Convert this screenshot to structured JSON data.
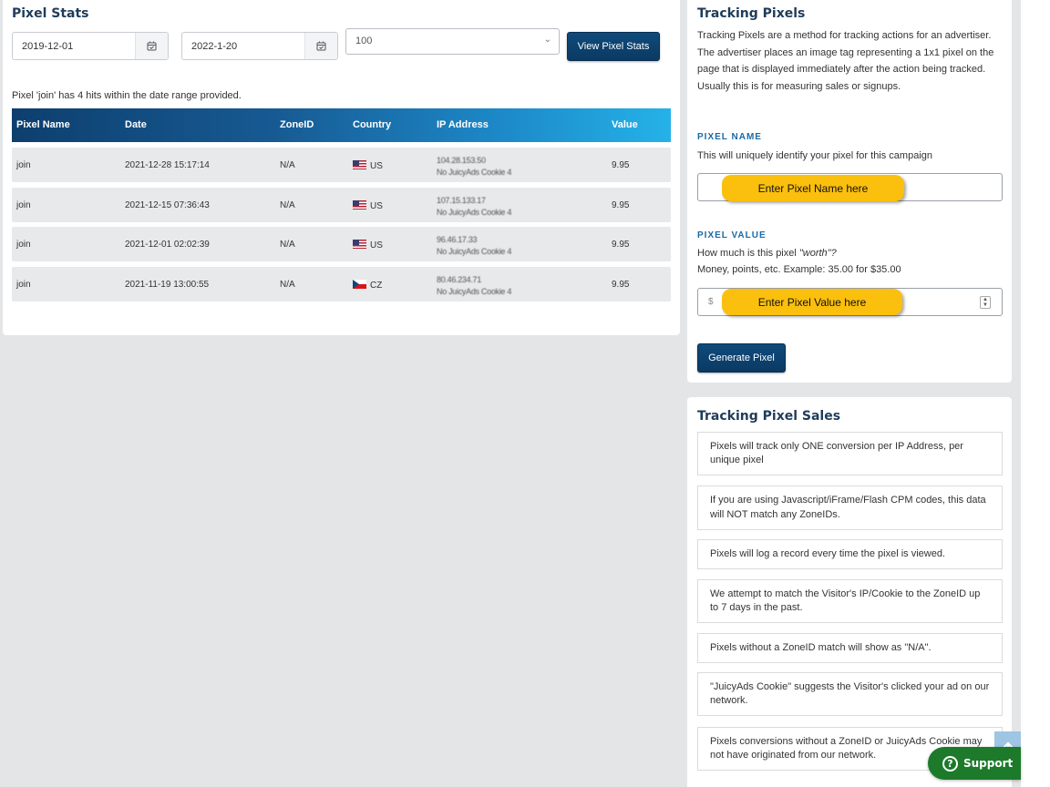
{
  "stats": {
    "title": "Pixel Stats",
    "start_date": "2019-12-01",
    "end_date": "2022-1-20",
    "limit": "100",
    "view_button": "View Pixel Stats",
    "info": "Pixel 'join' has 4 hits within the date range provided.",
    "columns": [
      "Pixel Name",
      "Date",
      "ZoneID",
      "Country",
      "IP Address",
      "Value"
    ],
    "rows": [
      {
        "name": "join",
        "date": "2021-12-28 15:17:14",
        "zone": "N/A",
        "country": "US",
        "ip": "104.28.153.50",
        "source": "No JuicyAds Cookie 4",
        "value": "9.95"
      },
      {
        "name": "join",
        "date": "2021-12-15 07:36:43",
        "zone": "N/A",
        "country": "US",
        "ip": "107.15.133.17",
        "source": "No JuicyAds Cookie 4",
        "value": "9.95"
      },
      {
        "name": "join",
        "date": "2021-12-01 02:02:39",
        "zone": "N/A",
        "country": "US",
        "ip": "96.46.17.33",
        "source": "No JuicyAds Cookie 4",
        "value": "9.95"
      },
      {
        "name": "join",
        "date": "2021-11-19 13:00:55",
        "zone": "N/A",
        "country": "CZ",
        "ip": "80.46.234.71",
        "source": "No JuicyAds Cookie 4",
        "value": "9.95"
      }
    ]
  },
  "tracking": {
    "title": "Tracking Pixels",
    "description": "Tracking Pixels are a method for tracking actions for an advertiser. The advertiser places an image tag representing a 1x1 pixel on the page that is displayed immediately after the action being tracked. Usually this is for measuring sales or signups.",
    "name_label": "PIXEL NAME",
    "name_help": "This will uniquely identify your pixel for this campaign",
    "name_callout": "Enter Pixel Name here",
    "value_label": "PIXEL VALUE",
    "value_help_prefix": "How much is this pixel ",
    "value_help_worth": "\"worth\"?",
    "value_help_2": "Money, points, etc. Example: 35.00 for $35.00",
    "currency": "$",
    "value_callout": "Enter Pixel Value here",
    "generate_button": "Generate Pixel"
  },
  "sales": {
    "title": "Tracking Pixel Sales",
    "notes": [
      "Pixels will track only ONE conversion per IP Address, per unique pixel",
      "If you are using Javascript/iFrame/Flash CPM codes, this data will NOT match any ZoneIDs.",
      "Pixels will log a record every time the pixel is viewed.",
      "We attempt to match the Visitor's IP/Cookie to the ZoneID up to 7 days in the past.",
      "Pixels without a ZoneID match will show as \"N/A\".",
      "\"JuicyAds Cookie\" suggests the Visitor's clicked your ad on our network.",
      "Pixels conversions without a ZoneID or JuicyAds Cookie may not have originated from our network."
    ]
  },
  "support": {
    "label": "Support"
  },
  "colors": {
    "primary": "#0b3a64",
    "accent": "#25b2e8",
    "callout": "#fbbf0e",
    "support": "#1c7a2a"
  }
}
